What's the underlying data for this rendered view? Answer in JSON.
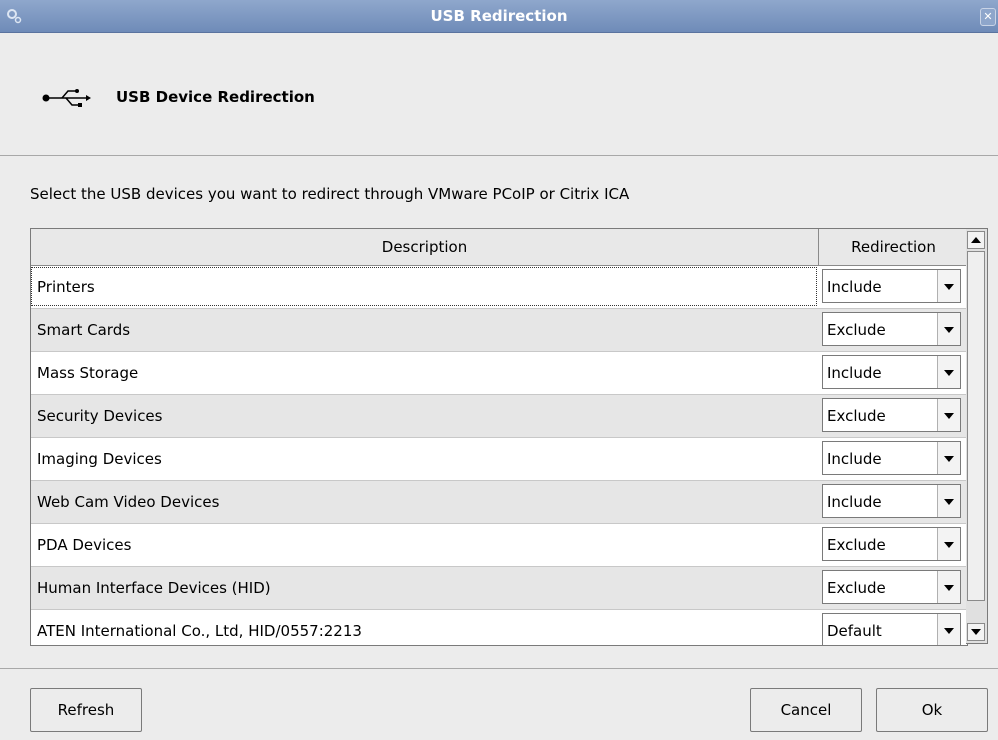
{
  "window": {
    "title": "USB Redirection"
  },
  "header": {
    "title": "USB Device Redirection",
    "icon": "usb-icon"
  },
  "instruction": "Select the USB devices you want to redirect through VMware PCoIP or Citrix ICA",
  "table": {
    "columns": [
      "Description",
      "Redirection"
    ],
    "rows": [
      {
        "description": "Printers",
        "redirection": "Include"
      },
      {
        "description": "Smart Cards",
        "redirection": "Exclude"
      },
      {
        "description": "Mass Storage",
        "redirection": "Include"
      },
      {
        "description": "Security Devices",
        "redirection": "Exclude"
      },
      {
        "description": "Imaging Devices",
        "redirection": "Include"
      },
      {
        "description": "Web Cam Video Devices",
        "redirection": "Include"
      },
      {
        "description": "PDA Devices",
        "redirection": "Exclude"
      },
      {
        "description": "Human Interface Devices (HID)",
        "redirection": "Exclude"
      },
      {
        "description": "ATEN International Co., Ltd, HID/0557:2213",
        "redirection": "Default"
      }
    ]
  },
  "buttons": {
    "refresh": "Refresh",
    "cancel": "Cancel",
    "ok": "Ok"
  },
  "colors": {
    "titlebar": "#7f99c3",
    "row_alt": "#e6e6e6",
    "background": "#ececec"
  }
}
